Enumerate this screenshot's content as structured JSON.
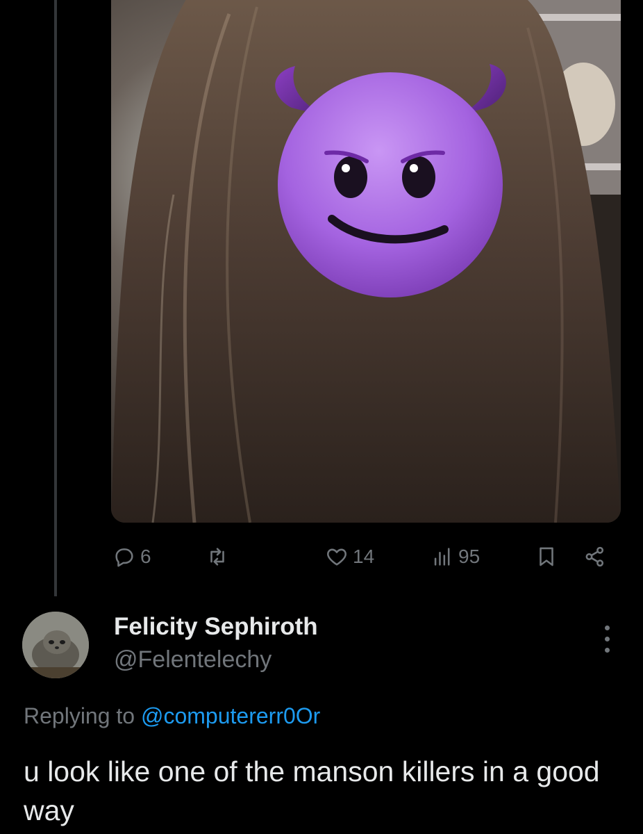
{
  "tweet": {
    "actions": {
      "reply_count": "6",
      "retweet_count": "",
      "like_count": "14",
      "views_count": "95"
    }
  },
  "reply": {
    "author_name": "Felicity Sephiroth",
    "author_handle": "@Felentelechy",
    "replying_prefix": "Replying to",
    "replying_mention": "@computererr0Or",
    "text": "u look like one of the manson killers in a good way"
  },
  "colors": {
    "background": "#000000",
    "text_primary": "#e7e9ea",
    "text_secondary": "#71767b",
    "link": "#1d9bf0",
    "emoji_purple": "#b06ee8"
  },
  "icons": [
    "reply-icon",
    "retweet-icon",
    "like-icon",
    "views-icon",
    "bookmark-icon",
    "share-icon",
    "more-icon",
    "devil-emoji"
  ]
}
